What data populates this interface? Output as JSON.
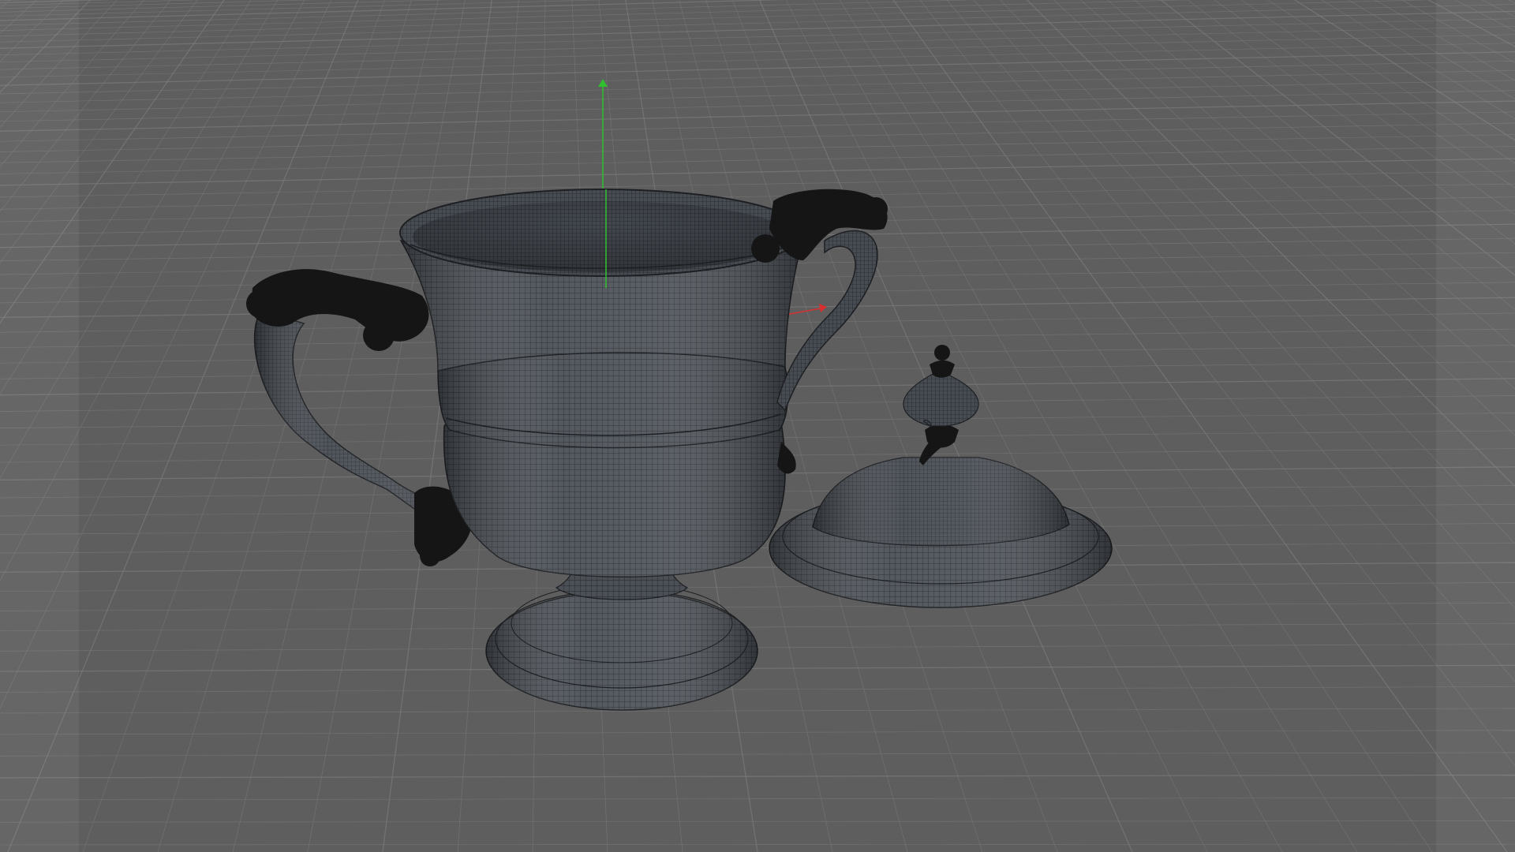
{
  "viewport": {
    "projection": "perspective",
    "display_mode": "wireframe-shaded",
    "background_color": "#5e5e5e",
    "grid": true,
    "grid_color": "#7a7a7a",
    "mesh_color": "#4a4f55",
    "mesh_line_color": "#2a2d31",
    "handle_color": "#141414",
    "axis_colors": {
      "x": "#d83030",
      "y": "#2fbf2f"
    }
  },
  "scene_objects": [
    {
      "name": "trophy-cup-body",
      "type": "mesh"
    },
    {
      "name": "trophy-cup-handle-left",
      "type": "mesh"
    },
    {
      "name": "trophy-cup-handle-right",
      "type": "mesh"
    },
    {
      "name": "trophy-cup-lid",
      "type": "mesh"
    }
  ]
}
